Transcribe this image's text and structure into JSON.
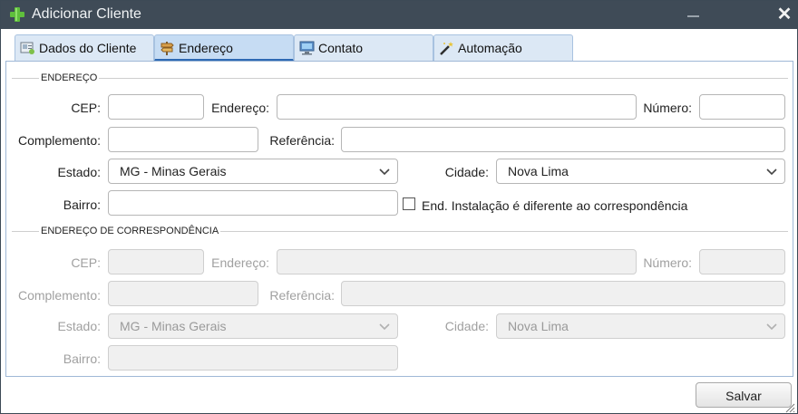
{
  "window": {
    "title": "Adicionar Cliente",
    "accent": "#3f4b57"
  },
  "tabs": [
    {
      "label": "Dados do Cliente",
      "icon": "client-data-icon"
    },
    {
      "label": "Endereço",
      "icon": "signpost-icon",
      "active": true
    },
    {
      "label": "Contato",
      "icon": "contact-computer-icon"
    },
    {
      "label": "Automação",
      "icon": "automation-wand-icon"
    }
  ],
  "address": {
    "section_title": "ENDEREÇO",
    "cep_label": "CEP:",
    "cep_value": "",
    "endereco_label": "Endereço:",
    "endereco_value": "",
    "numero_label": "Número:",
    "numero_value": "",
    "complemento_label": "Complemento:",
    "complemento_value": "",
    "referencia_label": "Referência:",
    "referencia_value": "",
    "estado_label": "Estado:",
    "estado_value": "MG - Minas Gerais",
    "cidade_label": "Cidade:",
    "cidade_value": "Nova Lima",
    "bairro_label": "Bairro:",
    "bairro_value": "",
    "diff_checkbox_label": "End. Instalação é diferente ao correspondência",
    "diff_checked": false
  },
  "correspondence": {
    "section_title": "ENDEREÇO DE CORRESPONDÊNCIA",
    "cep_label": "CEP:",
    "endereco_label": "Endereço:",
    "numero_label": "Número:",
    "complemento_label": "Complemento:",
    "referencia_label": "Referência:",
    "estado_label": "Estado:",
    "estado_value": "MG - Minas Gerais",
    "cidade_label": "Cidade:",
    "cidade_value": "Nova Lima",
    "bairro_label": "Bairro:"
  },
  "footer": {
    "save_label": "Salvar"
  }
}
